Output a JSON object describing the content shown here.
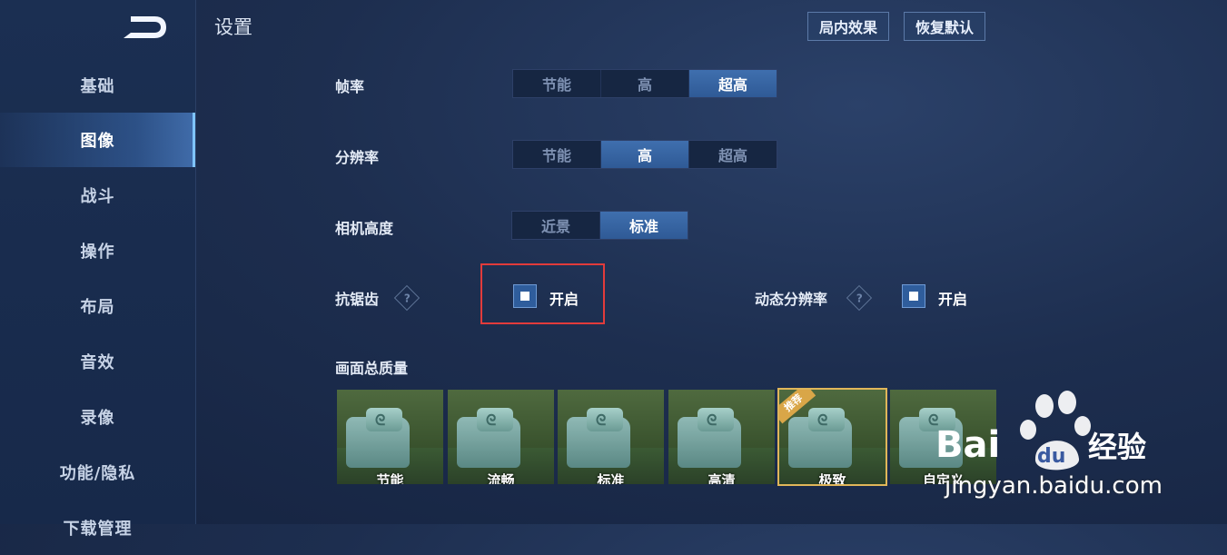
{
  "header": {
    "title": "设置",
    "in_game_effects_label": "局内效果",
    "restore_default_label": "恢复默认"
  },
  "sidebar": {
    "items": [
      {
        "label": "基础"
      },
      {
        "label": "图像"
      },
      {
        "label": "战斗"
      },
      {
        "label": "操作"
      },
      {
        "label": "布局"
      },
      {
        "label": "音效"
      },
      {
        "label": "录像"
      },
      {
        "label": "功能/隐私"
      },
      {
        "label": "下载管理"
      }
    ],
    "active_index": 1
  },
  "settings": {
    "frame_rate": {
      "label": "帧率",
      "options": [
        "节能",
        "高",
        "超高"
      ],
      "selected": "超高"
    },
    "resolution": {
      "label": "分辨率",
      "options": [
        "节能",
        "高",
        "超高"
      ],
      "selected": "高"
    },
    "camera_height": {
      "label": "相机高度",
      "options": [
        "近景",
        "标准"
      ],
      "selected": "标准"
    },
    "anti_aliasing": {
      "label": "抗锯齿",
      "help": "?",
      "checkbox_label": "开启",
      "checked": true
    },
    "dynamic_resolution": {
      "label": "动态分辨率",
      "help": "?",
      "checkbox_label": "开启",
      "checked": true
    },
    "overall_quality": {
      "label": "画面总质量",
      "presets": [
        "节能",
        "流畅",
        "标准",
        "高清",
        "极致",
        "自定义"
      ],
      "recommended_badge": "推荐",
      "recommended_index": 4
    }
  },
  "watermark": {
    "brand": "Bai du 经验",
    "url": "jingyan.baidu.com"
  },
  "colors": {
    "accent": "#3f6fae",
    "highlight_box": "#e23b3b",
    "recommended": "#e0b65a"
  }
}
